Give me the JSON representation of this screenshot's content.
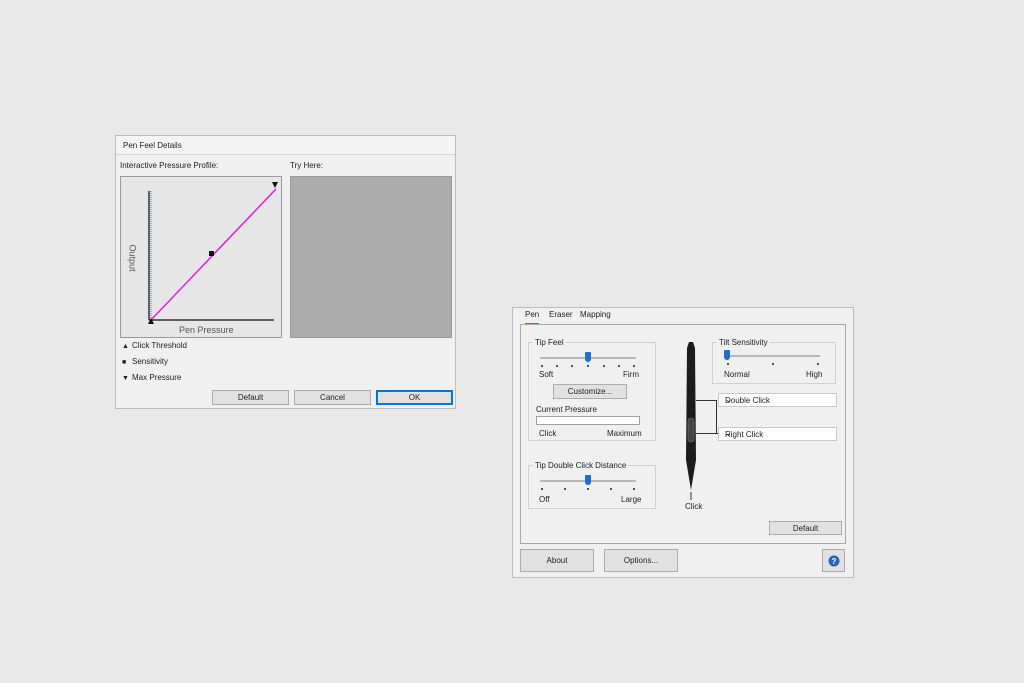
{
  "pen_feel_dialog": {
    "title": "Pen Feel Details",
    "profile_label": "Interactive Pressure Profile:",
    "try_here_label": "Try Here:",
    "graph": {
      "y_label": "Output",
      "x_label": "Pen Pressure"
    },
    "legend": [
      {
        "symbol": "▲",
        "label": "Click Threshold"
      },
      {
        "symbol": "■",
        "label": "Sensitivity"
      },
      {
        "symbol": "▼",
        "label": "Max Pressure"
      }
    ],
    "buttons": {
      "default": "Default",
      "cancel": "Cancel",
      "ok": "OK"
    },
    "curve_color": "#e020d8"
  },
  "wacom_properties": {
    "tabs": [
      "Pen",
      "Eraser",
      "Mapping"
    ],
    "active_tab": "Pen",
    "tip_feel": {
      "title": "Tip Feel",
      "min_label": "Soft",
      "max_label": "Firm",
      "level": 0.5,
      "customize_label": "Customize...",
      "current_pressure_label": "Current Pressure",
      "pressure_min_label": "Click",
      "pressure_max_label": "Maximum"
    },
    "tip_double_click": {
      "title": "Tip Double Click Distance",
      "min_label": "Off",
      "max_label": "Large",
      "level": 0.5
    },
    "tilt_sensitivity": {
      "title": "Tilt Sensitivity",
      "min_label": "Normal",
      "max_label": "High",
      "level": 0.0
    },
    "pen_buttons": {
      "upper": "Double Click",
      "lower": "Right Click",
      "tip": "Click"
    },
    "default_label": "Default",
    "about_label": "About",
    "options_label": "Options...",
    "help_icon": "help-icon",
    "accent_color": "#1f6fd1"
  }
}
